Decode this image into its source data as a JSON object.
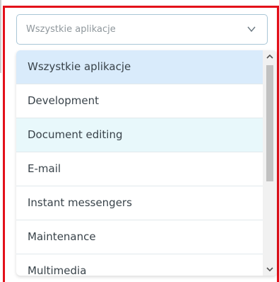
{
  "select": {
    "value": "Wszystkie aplikacje",
    "chevron_icon": "chevron-down-icon"
  },
  "dropdown": {
    "options": [
      {
        "label": "Wszystkie aplikacje",
        "state": "selected"
      },
      {
        "label": "Development",
        "state": "normal"
      },
      {
        "label": "Document editing",
        "state": "hover"
      },
      {
        "label": "E-mail",
        "state": "normal"
      },
      {
        "label": "Instant messengers",
        "state": "normal"
      },
      {
        "label": "Maintenance",
        "state": "normal"
      },
      {
        "label": "Multimedia",
        "state": "normal"
      }
    ],
    "scroll_up_icon": "scroll-up-arrow-icon",
    "scroll_down_icon": "scroll-down-arrow-icon"
  },
  "colors": {
    "highlight_border": "#e3101a",
    "selected_bg": "#d9ebfb",
    "hover_bg": "#e8f8fb"
  }
}
